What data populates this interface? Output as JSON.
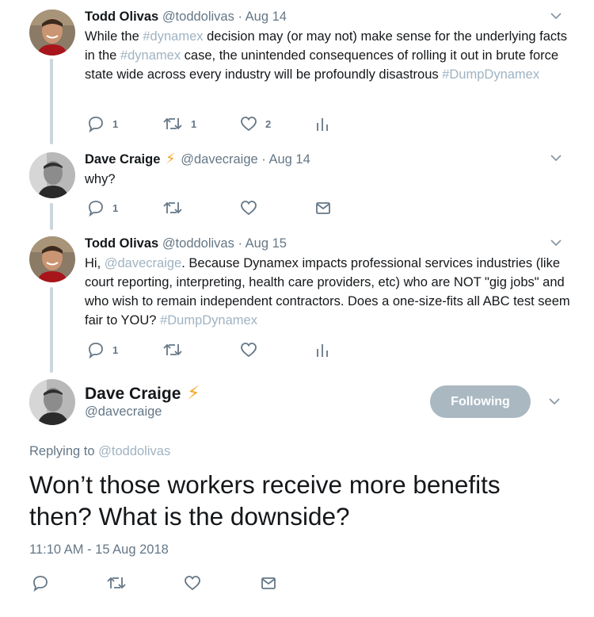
{
  "colors": {
    "text": "#14171a",
    "muted": "#657786",
    "link_faded": "#9fb3c2",
    "thread_line": "#ccd6dd",
    "follow_button": "#aab8c2",
    "bolt": "#f5a623"
  },
  "tweets": [
    {
      "name": "Todd Olivas",
      "handle": "@toddolivas",
      "sep": "·",
      "date": "Aug 14",
      "text": {
        "p1": "While the ",
        "tag1": "#dynamex",
        "p2": " decision may (or may not) make sense for the underlying facts in the ",
        "tag2": "#dynamex",
        "p3": " case, the unintended consequences of rolling it out in brute force state wide across every industry will be profoundly disastrous ",
        "tag3": "#DumpDynamex"
      },
      "replies": "1",
      "retweets": "1",
      "likes": "2",
      "last_icon": "analytics-icon"
    },
    {
      "name": "Dave Craige",
      "bolt": "⚡",
      "handle": "@davecraige",
      "sep": "·",
      "date": "Aug 14",
      "text": "why?",
      "replies": "1",
      "last_icon": "message-icon"
    },
    {
      "name": "Todd Olivas",
      "handle": "@toddolivas",
      "sep": "·",
      "date": "Aug 15",
      "text": {
        "p1": "Hi, ",
        "mention": "@davecraige",
        "p2": ". Because Dynamex impacts professional services industries (like court reporting, interpreting, health care providers, etc) who are NOT \"gig jobs\" and who wish to remain independent contractors. Does a one-size-fits all ABC test seem fair to YOU? ",
        "tag": "#DumpDynamex"
      },
      "replies": "1",
      "last_icon": "analytics-icon"
    }
  ],
  "main": {
    "name": "Dave Craige",
    "bolt": "⚡",
    "handle": "@davecraige",
    "follow_label": "Following",
    "replying_prefix": "Replying to ",
    "replying_to": "@toddolivas",
    "text": "Won’t those workers receive more benefits then?  What is the downside?",
    "timestamp": "11:10 AM - 15 Aug 2018"
  }
}
